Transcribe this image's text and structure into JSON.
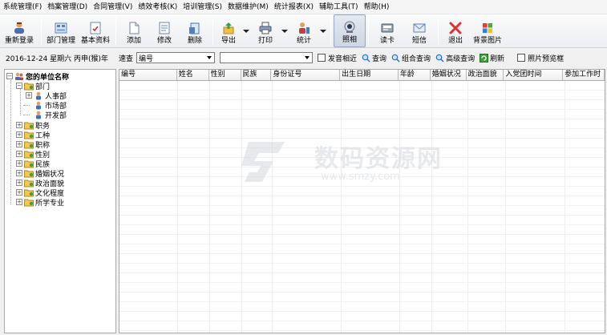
{
  "menu": [
    "系统管理(F)",
    "档案管理(D)",
    "合同管理(V)",
    "绩效考核(K)",
    "培训管理(S)",
    "数据维护(M)",
    "统计报表(X)",
    "辅助工具(T)",
    "帮助(H)"
  ],
  "toolbar": {
    "relogin": "重新登录",
    "dept_manage": "部门管理",
    "basic_info": "基本资料",
    "add": "添加",
    "edit": "修改",
    "delete": "删除",
    "export": "导出",
    "print": "打印",
    "stats": "统计",
    "photo": "照相",
    "card_reader": "读卡",
    "sms": "短信",
    "exit": "退出",
    "background": "背景图片"
  },
  "filterbar": {
    "date": "2016-12-24 星期六 丙申(猴)年",
    "quick_query_label": "速查",
    "field_select": "编号",
    "value_select": "",
    "phonetic_label": "发音相近",
    "query": "查询",
    "combo_query": "组合查询",
    "advanced_query": "高级查询",
    "refresh": "刷新",
    "photo_preview": "照片预览框"
  },
  "tree": {
    "root": "您的单位名称",
    "department": "部门",
    "departments": [
      "人事部",
      "市场部",
      "开发部"
    ],
    "nodes": [
      "职务",
      "工种",
      "职称",
      "性别",
      "民族",
      "婚姻状况",
      "政治面貌",
      "文化程度",
      "所学专业"
    ]
  },
  "grid": {
    "columns": [
      "编号",
      "姓名",
      "性别",
      "民族",
      "身份证号",
      "出生日期",
      "年龄",
      "婚姻状况",
      "政治面貌",
      "入党团时间",
      "参加工作时"
    ]
  },
  "watermark": {
    "text": "数码资源网",
    "url": "www.smzy.com"
  },
  "colors": {
    "folder": "#e8b830",
    "accent_blue": "#2a6fc9",
    "grid_line": "#eef0f2"
  }
}
